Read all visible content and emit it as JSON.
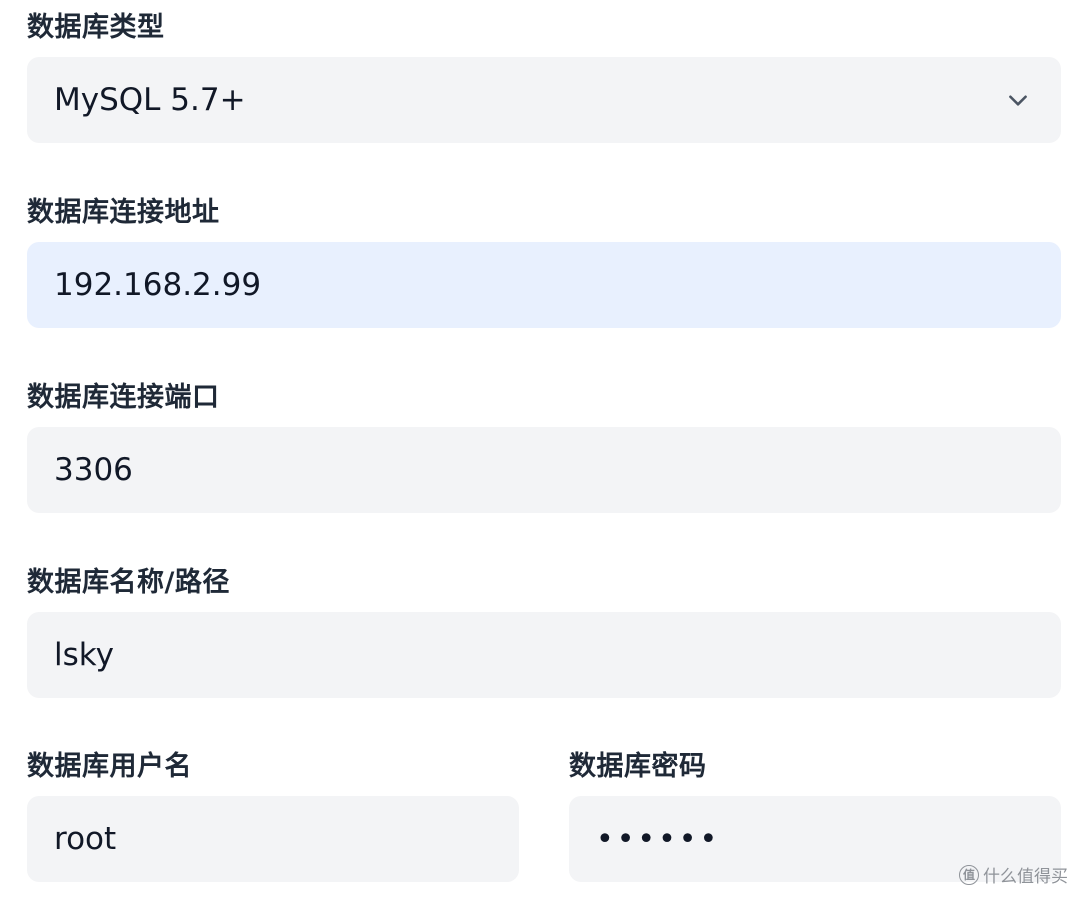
{
  "form": {
    "db_type": {
      "label": "数据库类型",
      "value": "MySQL 5.7+"
    },
    "db_host": {
      "label": "数据库连接地址",
      "value": "192.168.2.99"
    },
    "db_port": {
      "label": "数据库连接端口",
      "value": "3306"
    },
    "db_name": {
      "label": "数据库名称/路径",
      "value": "lsky"
    },
    "db_user": {
      "label": "数据库用户名",
      "value": "root"
    },
    "db_password": {
      "label": "数据库密码",
      "value": "••••••"
    }
  },
  "watermark": {
    "text": "什么值得买",
    "badge": "值"
  },
  "colors": {
    "field_bg": "#f3f4f6",
    "field_focus_bg": "#e8f0fe",
    "label_color": "#1f2937"
  }
}
